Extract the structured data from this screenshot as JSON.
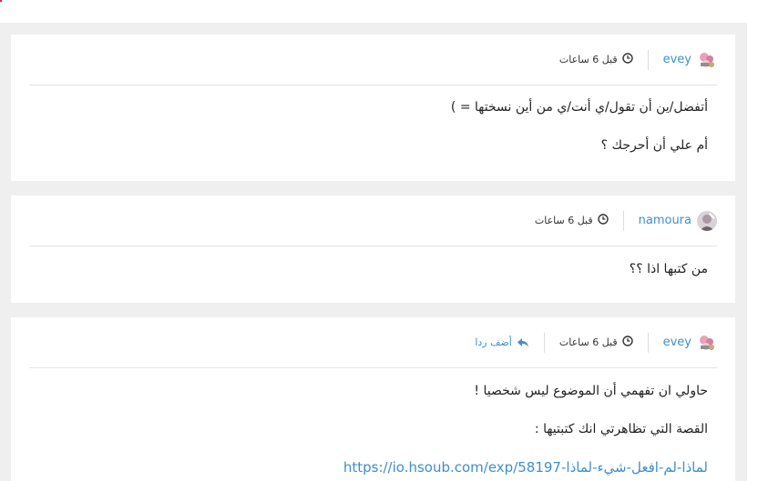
{
  "comments": [
    {
      "username": "evey",
      "time": "قبل 6 ساعات",
      "lines": [
        "أتفضل/ين أن تقول/ي أنت/ي من أين نسختها = )",
        "أم علي أن أحرجك ؟"
      ]
    },
    {
      "username": "namoura",
      "time": "قبل 6 ساعات",
      "lines": [
        "من كتبها اذا ؟؟"
      ]
    },
    {
      "username": "evey",
      "time": "قبل 6 ساعات",
      "reply_label": "أضف ردا",
      "lines": [
        "حاولي ان تفهمي أن الموضوع ليس شخصيا !",
        "القصة التي تظاهرتي انك كتبتيها :"
      ],
      "link": "https://io.hsoub.com/exp/58197-لماذا-لم-افعل-شيء-لماذا"
    }
  ],
  "icons": {
    "clock": "clock-icon",
    "reply": "reply-arrow-icon",
    "avatar_evey": "flower-avatar-icon",
    "avatar_namoura": "photo-avatar-icon"
  },
  "colors": {
    "link": "#3d8fcf",
    "background": "#efefef",
    "card": "#ffffff"
  }
}
